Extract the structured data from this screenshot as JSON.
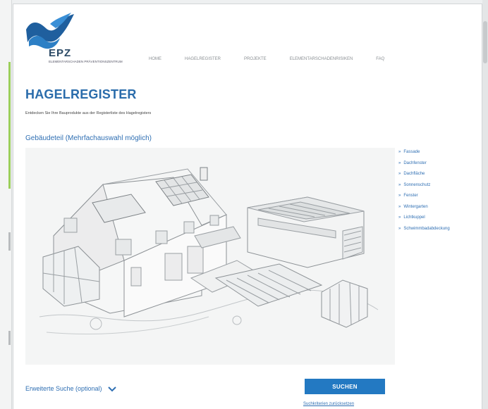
{
  "logo": {
    "name": "EPZ",
    "subtitle": "ELEMENTARSCHADEN PRÄVENTIONSZENTRUM"
  },
  "nav": {
    "items": [
      "HOME",
      "HAGELREGISTER",
      "PROJEKTE",
      "ELEMENTARSCHADENRISIKEN",
      "FAQ"
    ]
  },
  "page": {
    "title": "HAGELREGISTER",
    "subtitle": "Entdecken Sie Ihre Bauprodukte aus der Registerliste des Hagelregisters",
    "section_heading": "Gebäudeteil (Mehrfachauswahl möglich)"
  },
  "legend": {
    "items": [
      "Fassade",
      "Dachfenster",
      "Dachfläche",
      "Sonnenschutz",
      "Fenster",
      "Wintergarten",
      "Lichtkuppel",
      "Schwimmbadabdeckung"
    ]
  },
  "search": {
    "advanced_label": "Erweiterte Suche (optional)",
    "button_label": "SUCHEN",
    "reset_label": "Suchkriterien zurücksetzen"
  },
  "colors": {
    "accent": "#2379c2",
    "brand": "#2b4a66",
    "green_marker": "#9bcf5a"
  }
}
